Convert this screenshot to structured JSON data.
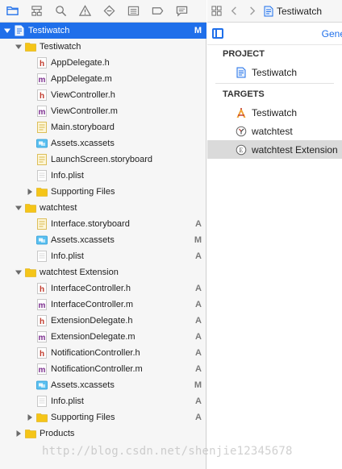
{
  "navigator": {
    "toolbar_icons": [
      "folder-icon",
      "hierarchy-icon",
      "search-icon",
      "warning-icon",
      "diamond-icon",
      "list-icon",
      "tag-icon",
      "comment-icon"
    ],
    "tree": [
      {
        "label": "Testiwatch",
        "level": 0,
        "type": "project",
        "expanded": true,
        "status": "M",
        "selected": true
      },
      {
        "label": "Testiwatch",
        "level": 1,
        "type": "folder",
        "expanded": true,
        "status": ""
      },
      {
        "label": "AppDelegate.h",
        "level": 2,
        "type": "h",
        "status": ""
      },
      {
        "label": "AppDelegate.m",
        "level": 2,
        "type": "m",
        "status": ""
      },
      {
        "label": "ViewController.h",
        "level": 2,
        "type": "h",
        "status": ""
      },
      {
        "label": "ViewController.m",
        "level": 2,
        "type": "m",
        "status": ""
      },
      {
        "label": "Main.storyboard",
        "level": 2,
        "type": "storyboard",
        "status": ""
      },
      {
        "label": "Assets.xcassets",
        "level": 2,
        "type": "xcassets",
        "status": ""
      },
      {
        "label": "LaunchScreen.storyboard",
        "level": 2,
        "type": "storyboard",
        "status": ""
      },
      {
        "label": "Info.plist",
        "level": 2,
        "type": "plist",
        "status": ""
      },
      {
        "label": "Supporting Files",
        "level": 2,
        "type": "folder",
        "expanded": false,
        "status": ""
      },
      {
        "label": "watchtest",
        "level": 1,
        "type": "folder",
        "expanded": true,
        "status": ""
      },
      {
        "label": "Interface.storyboard",
        "level": 2,
        "type": "storyboard",
        "status": "A"
      },
      {
        "label": "Assets.xcassets",
        "level": 2,
        "type": "xcassets",
        "status": "M"
      },
      {
        "label": "Info.plist",
        "level": 2,
        "type": "plist",
        "status": "A"
      },
      {
        "label": "watchtest Extension",
        "level": 1,
        "type": "folder",
        "expanded": true,
        "status": ""
      },
      {
        "label": "InterfaceController.h",
        "level": 2,
        "type": "h",
        "status": "A"
      },
      {
        "label": "InterfaceController.m",
        "level": 2,
        "type": "m",
        "status": "A"
      },
      {
        "label": "ExtensionDelegate.h",
        "level": 2,
        "type": "h",
        "status": "A"
      },
      {
        "label": "ExtensionDelegate.m",
        "level": 2,
        "type": "m",
        "status": "A"
      },
      {
        "label": "NotificationController.h",
        "level": 2,
        "type": "h",
        "status": "A"
      },
      {
        "label": "NotificationController.m",
        "level": 2,
        "type": "m",
        "status": "A"
      },
      {
        "label": "Assets.xcassets",
        "level": 2,
        "type": "xcassets",
        "status": "M"
      },
      {
        "label": "Info.plist",
        "level": 2,
        "type": "plist",
        "status": "A"
      },
      {
        "label": "Supporting Files",
        "level": 2,
        "type": "folder",
        "expanded": false,
        "status": "A"
      },
      {
        "label": "Products",
        "level": 1,
        "type": "folder",
        "expanded": false,
        "status": ""
      }
    ]
  },
  "editor": {
    "breadcrumb_label": "Testiwatch",
    "general_tab": "Gene",
    "project_header": "PROJECT",
    "project_item": "Testiwatch",
    "targets_header": "TARGETS",
    "targets": [
      {
        "label": "Testiwatch",
        "icon": "app-target-icon",
        "selected": false
      },
      {
        "label": "watchtest",
        "icon": "watch-app-icon",
        "selected": false
      },
      {
        "label": "watchtest Extension",
        "icon": "extension-icon",
        "selected": true
      }
    ]
  },
  "watermark": "http://blog.csdn.net/shenjie12345678",
  "colors": {
    "accent": "#1f6fea",
    "folder": "#f5c518",
    "m_file": "#7b2d8e",
    "h_file": "#c0392b"
  }
}
